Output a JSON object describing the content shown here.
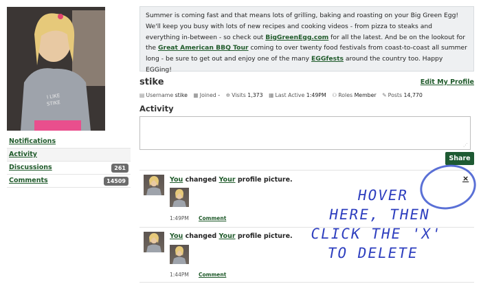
{
  "sidebar": {
    "items": [
      {
        "label": "Notifications",
        "badge": null
      },
      {
        "label": "Activity",
        "badge": null
      },
      {
        "label": "Discussions",
        "badge": "261"
      },
      {
        "label": "Comments",
        "badge": "14509"
      }
    ]
  },
  "announcement": {
    "t1": "Summer is coming fast and that means lots of grilling, baking and roasting on your Big Green Egg! We'll keep you busy with lots of new recipes and cooking videos - from pizza to steaks and everything in-between - so check out ",
    "link1": "BigGreenEgg.com",
    "t2": " for all the latest. And be on the lookout for the ",
    "link2": "Great American BBQ Tour",
    "t3": " coming to over twenty food festivals from coast-to-coast all summer long - be sure to get out and enjoy one of the many ",
    "link3": "EGGfests",
    "t4": " around the country too. Happy EGGing!"
  },
  "profile": {
    "name": "stike",
    "edit_label": "Edit My Profile",
    "meta": {
      "username_label": "Username",
      "username": "stike",
      "joined_label": "Joined",
      "joined": "-",
      "visits_label": "Visits",
      "visits": "1,373",
      "last_active_label": "Last Active",
      "last_active": "1:49PM",
      "roles_label": "Roles",
      "roles": "Member",
      "posts_label": "Posts",
      "posts": "14,770"
    }
  },
  "activity": {
    "title": "Activity",
    "share_label": "Share",
    "items": [
      {
        "actor": "You",
        "verb": "changed",
        "owner": "Your",
        "object": "profile picture.",
        "time": "1:49PM",
        "comment_label": "Comment"
      },
      {
        "actor": "You",
        "verb": "changed",
        "owner": "Your",
        "object": "profile picture.",
        "time": "1:44PM",
        "comment_label": "Comment"
      }
    ],
    "delete_label": "×"
  },
  "annotation": {
    "line1": "HOVER",
    "line2": "HERE, THEN",
    "line3": "CLICK THE 'X'",
    "line4": "TO DELETE"
  },
  "colors": {
    "link": "#1f5a2a",
    "share_button": "#1e5a33",
    "badge": "#6b6b6b",
    "annotation": "#2e3fbf"
  }
}
